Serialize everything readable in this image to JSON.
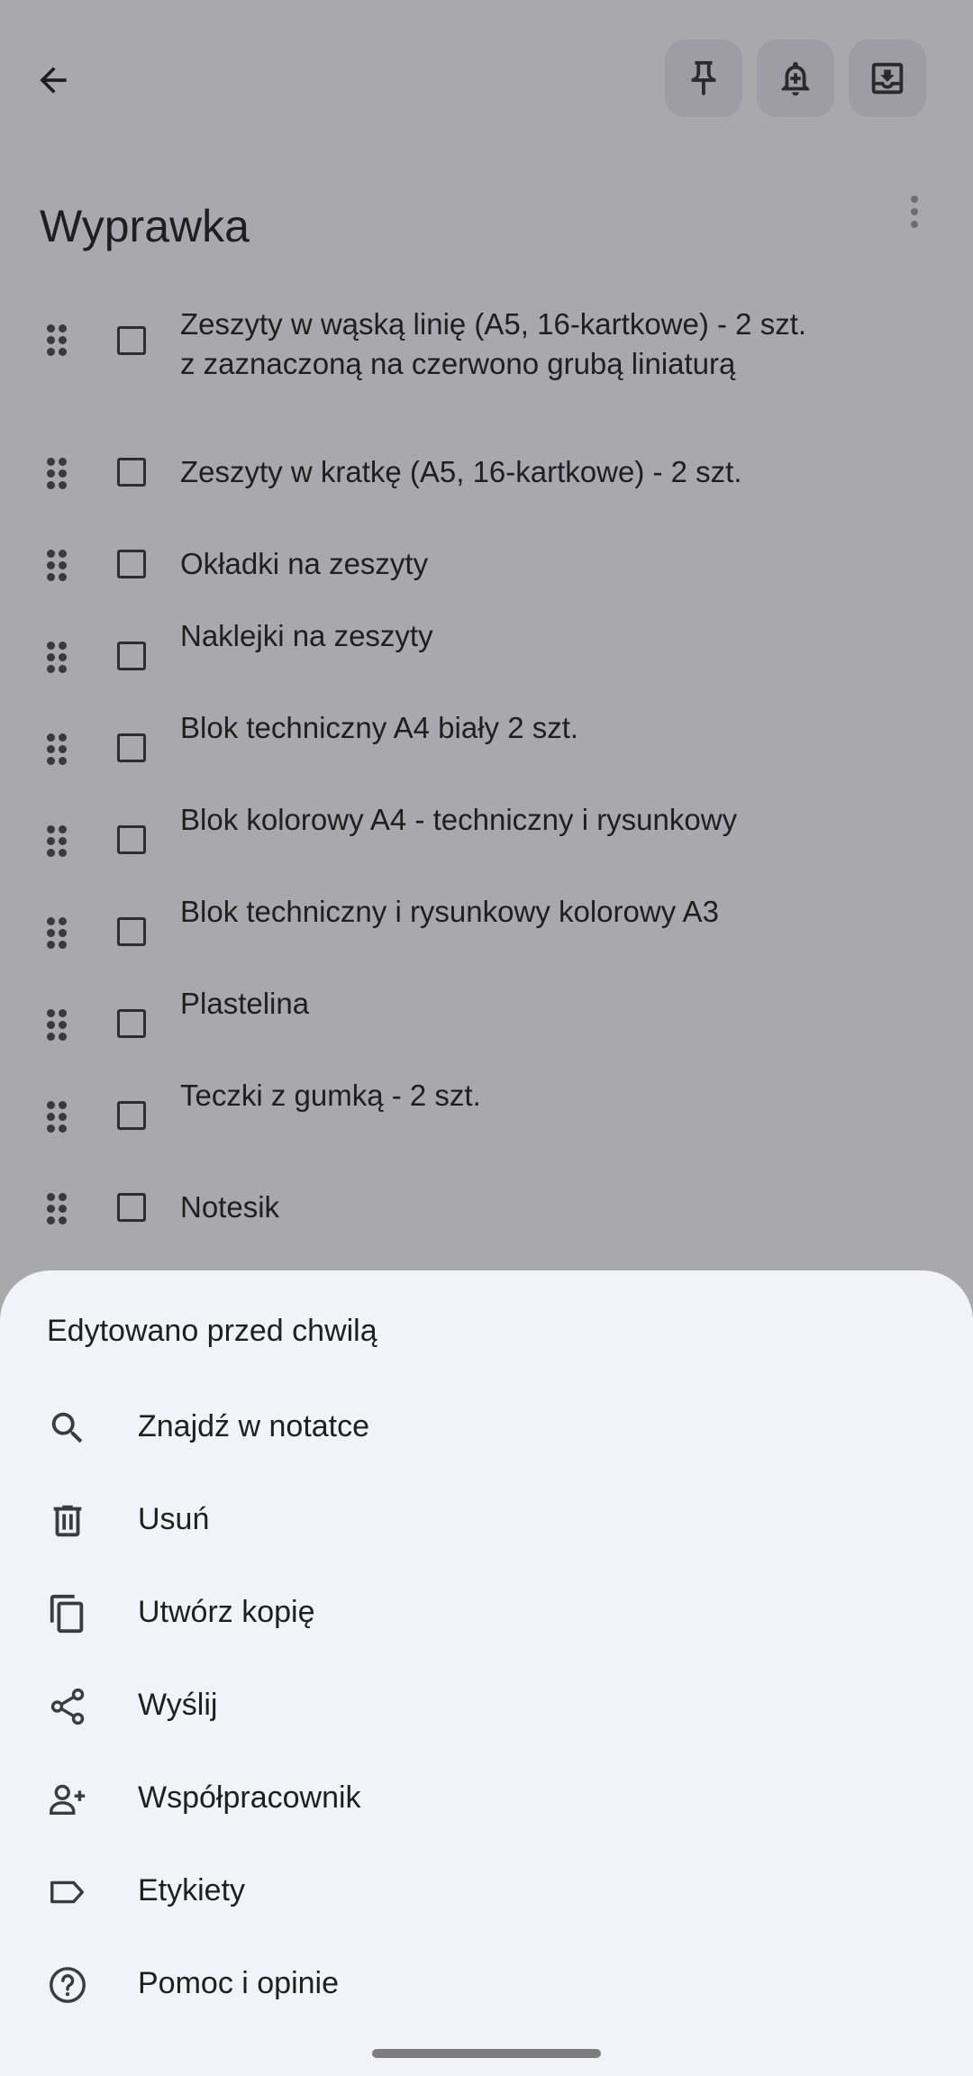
{
  "note": {
    "title": "Wyprawka",
    "items": [
      {
        "text": "Zeszyty w wąską linię (A5, 16-kartkowe) - 2 szt.\nz zaznaczoną na czerwono grubą liniaturą",
        "checked": false
      },
      {
        "text": "Zeszyty w kratkę (A5, 16-kartkowe) - 2 szt.",
        "checked": false
      },
      {
        "text": "Okładki na zeszyty",
        "checked": false
      },
      {
        "text": "Naklejki na zeszyty",
        "checked": false
      },
      {
        "text": "Blok techniczny A4 biały 2 szt.",
        "checked": false
      },
      {
        "text": "Blok kolorowy A4 - techniczny i rysunkowy",
        "checked": false
      },
      {
        "text": "Blok techniczny i rysunkowy kolorowy A3",
        "checked": false
      },
      {
        "text": "Plastelina",
        "checked": false
      },
      {
        "text": "Teczki z gumką - 2 szt.",
        "checked": false
      },
      {
        "text": "Notesik",
        "checked": false
      }
    ]
  },
  "toolbar": {
    "icons": [
      "back-arrow-icon",
      "pin-icon",
      "reminder-bell-icon",
      "archive-icon",
      "more-vert-icon"
    ]
  },
  "sheet": {
    "title": "Edytowano przed chwilą",
    "items": [
      {
        "label": "Znajdź w notatce",
        "icon": "search-icon"
      },
      {
        "label": "Usuń",
        "icon": "trash-icon"
      },
      {
        "label": "Utwórz kopię",
        "icon": "copy-icon"
      },
      {
        "label": "Wyślij",
        "icon": "share-icon"
      },
      {
        "label": "Współpracownik",
        "icon": "add-person-icon"
      },
      {
        "label": "Etykiety",
        "icon": "label-icon"
      },
      {
        "label": "Pomoc i opinie",
        "icon": "help-icon"
      }
    ]
  },
  "colors": {
    "scrim_background": "#a9a8ad",
    "sheet_background": "#f2f3f8",
    "action_button": "#9e9da3",
    "text": "#1f1f1f"
  }
}
